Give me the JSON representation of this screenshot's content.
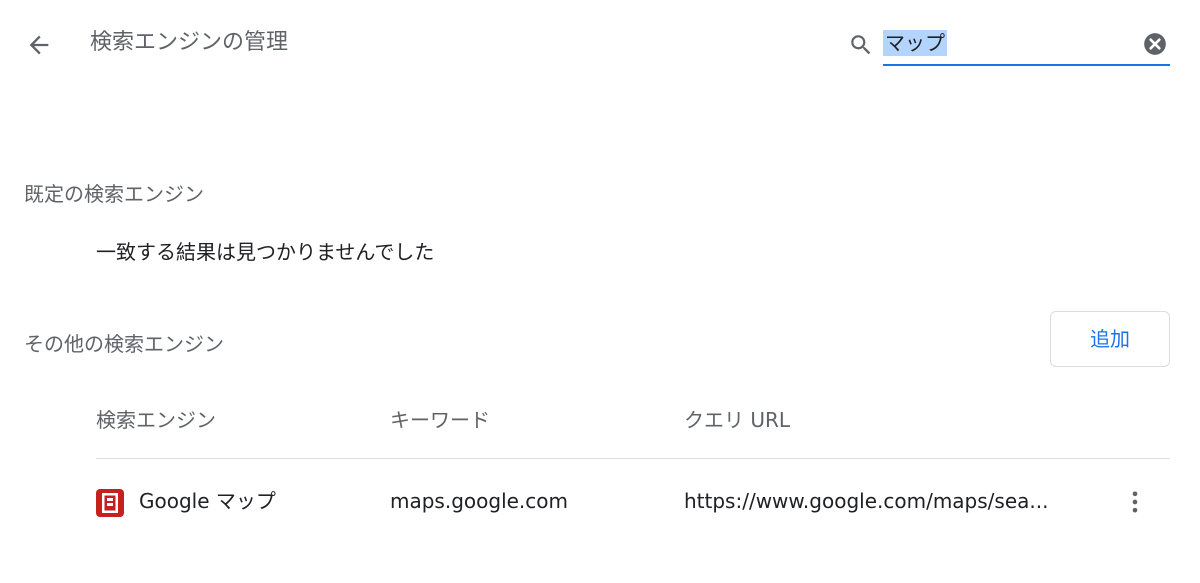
{
  "header": {
    "title": "検索エンジンの管理",
    "back_icon": "arrow-left-icon",
    "search": {
      "value": "マップ",
      "placeholder": "",
      "icon": "search-icon",
      "clear_icon": "clear-icon"
    }
  },
  "default_section": {
    "label": "既定の検索エンジン",
    "empty_message": "一致する結果は見つかりませんでした"
  },
  "other_section": {
    "label": "その他の検索エンジン",
    "add_button": "追加"
  },
  "table": {
    "columns": [
      "検索エンジン",
      "キーワード",
      "クエリ URL"
    ],
    "rows": [
      {
        "icon": "google-maps-favicon",
        "name": "Google マップ",
        "keyword": "maps.google.com",
        "url": "https://www.google.com/maps/sea...",
        "more_icon": "more-vertical-icon"
      }
    ]
  },
  "colors": {
    "accent": "#1a73e8",
    "secondary_text": "#5f6368",
    "primary_text": "#202124",
    "favicon_red": "#c5221f"
  }
}
